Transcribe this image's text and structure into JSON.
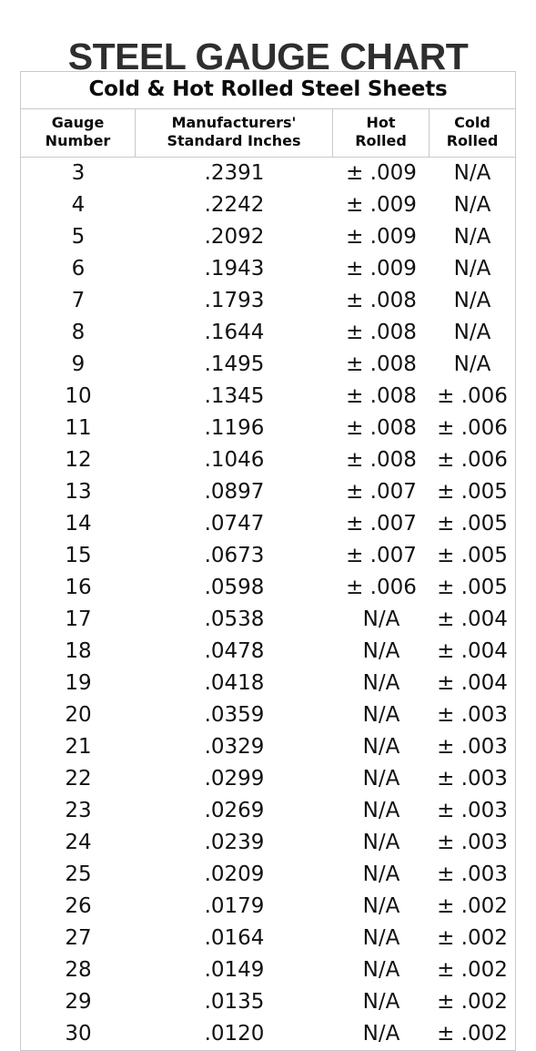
{
  "document": {
    "title": "STEEL GAUGE CHART",
    "subtitle": "Cold & Hot Rolled Steel Sheets"
  },
  "table": {
    "headers": [
      {
        "line1": "Gauge",
        "line2": "Number"
      },
      {
        "line1": "Manufacturers'",
        "line2": "Standard Inches"
      },
      {
        "line1": "Hot",
        "line2": "Rolled"
      },
      {
        "line1": "Cold",
        "line2": "Rolled"
      }
    ],
    "rows": [
      {
        "gauge": "3",
        "inches": ".2391",
        "hot": "± .009",
        "cold": "N/A"
      },
      {
        "gauge": "4",
        "inches": ".2242",
        "hot": "± .009",
        "cold": "N/A"
      },
      {
        "gauge": "5",
        "inches": ".2092",
        "hot": "± .009",
        "cold": "N/A"
      },
      {
        "gauge": "6",
        "inches": ".1943",
        "hot": "± .009",
        "cold": "N/A"
      },
      {
        "gauge": "7",
        "inches": ".1793",
        "hot": "± .008",
        "cold": "N/A"
      },
      {
        "gauge": "8",
        "inches": ".1644",
        "hot": "± .008",
        "cold": "N/A"
      },
      {
        "gauge": "9",
        "inches": ".1495",
        "hot": "± .008",
        "cold": "N/A"
      },
      {
        "gauge": "10",
        "inches": ".1345",
        "hot": "± .008",
        "cold": "± .006"
      },
      {
        "gauge": "11",
        "inches": ".1196",
        "hot": "± .008",
        "cold": "± .006"
      },
      {
        "gauge": "12",
        "inches": ".1046",
        "hot": "± .008",
        "cold": "± .006"
      },
      {
        "gauge": "13",
        "inches": ".0897",
        "hot": "± .007",
        "cold": "± .005"
      },
      {
        "gauge": "14",
        "inches": ".0747",
        "hot": "± .007",
        "cold": "± .005"
      },
      {
        "gauge": "15",
        "inches": ".0673",
        "hot": "± .007",
        "cold": "± .005"
      },
      {
        "gauge": "16",
        "inches": ".0598",
        "hot": "± .006",
        "cold": "± .005"
      },
      {
        "gauge": "17",
        "inches": ".0538",
        "hot": "N/A",
        "cold": "± .004"
      },
      {
        "gauge": "18",
        "inches": ".0478",
        "hot": "N/A",
        "cold": "± .004"
      },
      {
        "gauge": "19",
        "inches": ".0418",
        "hot": "N/A",
        "cold": "± .004"
      },
      {
        "gauge": "20",
        "inches": ".0359",
        "hot": "N/A",
        "cold": "± .003"
      },
      {
        "gauge": "21",
        "inches": ".0329",
        "hot": "N/A",
        "cold": "± .003"
      },
      {
        "gauge": "22",
        "inches": ".0299",
        "hot": "N/A",
        "cold": "± .003"
      },
      {
        "gauge": "23",
        "inches": ".0269",
        "hot": "N/A",
        "cold": "± .003"
      },
      {
        "gauge": "24",
        "inches": ".0239",
        "hot": "N/A",
        "cold": "± .003"
      },
      {
        "gauge": "25",
        "inches": ".0209",
        "hot": "N/A",
        "cold": "± .003"
      },
      {
        "gauge": "26",
        "inches": ".0179",
        "hot": "N/A",
        "cold": "± .002"
      },
      {
        "gauge": "27",
        "inches": ".0164",
        "hot": "N/A",
        "cold": "± .002"
      },
      {
        "gauge": "28",
        "inches": ".0149",
        "hot": "N/A",
        "cold": "± .002"
      },
      {
        "gauge": "29",
        "inches": ".0135",
        "hot": "N/A",
        "cold": "± .002"
      },
      {
        "gauge": "30",
        "inches": ".0120",
        "hot": "N/A",
        "cold": "± .002"
      }
    ]
  },
  "colors": {
    "title_text": "#2e2e2e",
    "body_text": "#121212",
    "border": "#c8c8c8",
    "background": "#ffffff"
  }
}
